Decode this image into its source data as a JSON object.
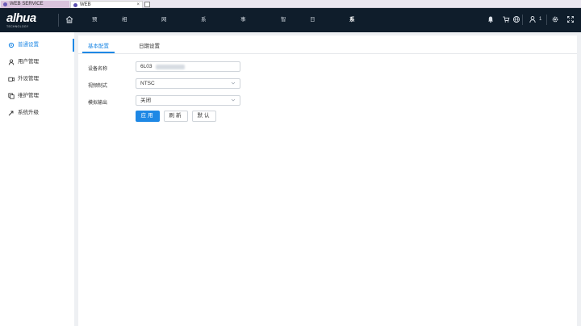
{
  "browser": {
    "tabs": [
      {
        "label": "WEB SERVICE",
        "close": ""
      },
      {
        "label": "WEB",
        "close": "×"
      }
    ]
  },
  "header": {
    "logo": "alhua",
    "logo_sub": "TECHNOLOGY",
    "menu": [
      "预览",
      "相机设置",
      "网络设置",
      "系统信息",
      "事件管理",
      "智能",
      "日志信息",
      "系统管理"
    ],
    "active_menu": "系统管理",
    "user_count": "1"
  },
  "sidebar": {
    "items": [
      {
        "label": "普通设置",
        "icon": "settings-icon"
      },
      {
        "label": "用户管理",
        "icon": "user-icon"
      },
      {
        "label": "外设管理",
        "icon": "peripheral-icon"
      },
      {
        "label": "维护管理",
        "icon": "maintenance-icon"
      },
      {
        "label": "系统升级",
        "icon": "upgrade-icon"
      }
    ]
  },
  "main": {
    "tabs": [
      "基本配置",
      "日期设置"
    ],
    "form": {
      "device_name_label": "设备名称",
      "device_name_value": "6L03",
      "video_standard_label": "视频制式",
      "video_standard_value": "NTSC",
      "analog_output_label": "模拟输出",
      "analog_output_value": "关闭"
    },
    "buttons": {
      "apply": "应用",
      "refresh": "刷新",
      "default": "默认"
    }
  },
  "colors": {
    "accent": "#1e88e5",
    "nav_bg": "#0f1d2b"
  }
}
